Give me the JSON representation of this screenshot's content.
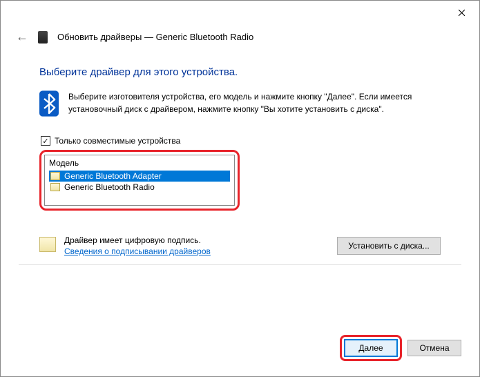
{
  "titlebar": {
    "close": "✕"
  },
  "header": {
    "title": "Обновить драйверы — Generic Bluetooth Radio"
  },
  "heading": "Выберите драйвер для этого устройства.",
  "info": "Выберите изготовителя устройства, его модель и нажмите кнопку \"Далее\". Если имеется установочный диск с  драйвером, нажмите кнопку \"Вы хотите установить с диска\".",
  "checkbox": {
    "label": "Только совместимые устройства",
    "checked": "✓"
  },
  "listbox": {
    "header": "Модель",
    "items": [
      {
        "label": "Generic Bluetooth Adapter",
        "selected": true
      },
      {
        "label": "Generic Bluetooth Radio",
        "selected": false
      }
    ]
  },
  "signature": {
    "title": "Драйвер имеет цифровую подпись.",
    "link": "Сведения о подписывании драйверов"
  },
  "buttons": {
    "install": "Установить с диска...",
    "next": "Далее",
    "cancel": "Отмена"
  }
}
